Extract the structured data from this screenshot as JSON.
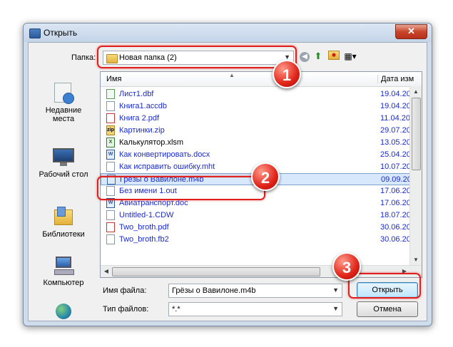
{
  "window": {
    "title": "Открыть",
    "close_label": "✕"
  },
  "toolbar": {
    "folder_label": "Папка:",
    "folder_value": "Новая папка (2)"
  },
  "places": [
    {
      "label": "Недавние места"
    },
    {
      "label": "Рабочий стол"
    },
    {
      "label": "Библиотеки"
    },
    {
      "label": "Компьютер"
    }
  ],
  "filelist": {
    "col_name": "Имя",
    "col_date": "Дата изм",
    "files": [
      {
        "name": "Лист1.dbf",
        "date": "19.04.20",
        "icon": "dbf-file-icon",
        "glyph": ""
      },
      {
        "name": "Книга1.accdb",
        "date": "19.04.20",
        "icon": "accdb-file-icon",
        "glyph": ""
      },
      {
        "name": "Книга 2.pdf",
        "date": "11.04.20",
        "icon": "pdf-file-icon",
        "glyph": ""
      },
      {
        "name": "Картинки.zip",
        "date": "29.07.20",
        "icon": "zip-file-icon",
        "glyph": "zip"
      },
      {
        "name": "Калькулятор.xlsm",
        "date": "13.05.20",
        "icon": "excel-file-icon",
        "glyph": "X"
      },
      {
        "name": "Как конвертировать.docx",
        "date": "25.04.20",
        "icon": "word-file-icon",
        "glyph": "W"
      },
      {
        "name": "Как исправить ошибку.mht",
        "date": "10.07.20",
        "icon": "mht-file-icon",
        "glyph": ""
      },
      {
        "name": "Грёзы о Вавилоне.m4b",
        "date": "09.09.20",
        "icon": "audio-file-icon",
        "glyph": ""
      },
      {
        "name": "Без имени 1.out",
        "date": "17.06.20",
        "icon": "out-file-icon",
        "glyph": ""
      },
      {
        "name": "Авиатранспорт.doc",
        "date": "17.06.20",
        "icon": "word-file-icon",
        "glyph": "W"
      },
      {
        "name": "Untitled-1.CDW",
        "date": "18.07.20",
        "icon": "cdw-file-icon",
        "glyph": ""
      },
      {
        "name": "Two_broth.pdf",
        "date": "30.06.20",
        "icon": "pdf-file-icon",
        "glyph": ""
      },
      {
        "name": "Two_broth.fb2",
        "date": "30.06.20",
        "icon": "fb2-file-icon",
        "glyph": ""
      }
    ]
  },
  "bottom": {
    "filename_label": "Имя файла:",
    "filename_value": "Грёзы о Вавилоне.m4b",
    "filetype_label": "Тип файлов:",
    "filetype_value": "*.*",
    "open_label": "Открыть",
    "cancel_label": "Отмена"
  },
  "badges": [
    "1",
    "2",
    "3"
  ],
  "colors": {
    "highlight": "#e0201c",
    "badge": "#e02418",
    "file_blue": "#1a2bcc"
  }
}
